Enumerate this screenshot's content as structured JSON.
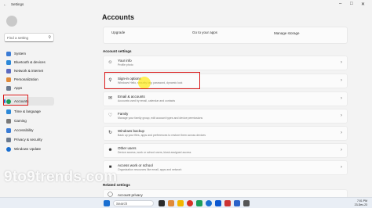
{
  "window": {
    "app_title": "Settings"
  },
  "sidebar": {
    "search_placeholder": "Find a setting",
    "items": [
      {
        "label": "System",
        "color": "#3a7bd5"
      },
      {
        "label": "Bluetooth & devices",
        "color": "#2b88d8"
      },
      {
        "label": "Network & internet",
        "color": "#5c6bc0"
      },
      {
        "label": "Personalization",
        "color": "#e08a3a"
      },
      {
        "label": "Apps",
        "color": "#6b7a8f"
      },
      {
        "label": "Accounts",
        "color": "#1a9e5a",
        "active": true
      },
      {
        "label": "Time & language",
        "color": "#2b88d8"
      },
      {
        "label": "Gaming",
        "color": "#7a7a7a"
      },
      {
        "label": "Accessibility",
        "color": "#3a7bd5"
      },
      {
        "label": "Privacy & security",
        "color": "#6b7a8f"
      },
      {
        "label": "Windows Update",
        "color": "#1a6fd1"
      }
    ]
  },
  "main": {
    "title": "Accounts",
    "top_card": {
      "upgrade": "Upgrade",
      "go_to_apps": "Go to your apps",
      "manage_storage": "Manage storage"
    },
    "section_account_settings": "Account settings",
    "rows": [
      {
        "title": "Your info",
        "subtitle": "Profile photo",
        "icon": "person-icon"
      },
      {
        "title": "Sign-in options",
        "subtitle": "Windows Hello, security key, password, dynamic lock",
        "icon": "key-icon"
      },
      {
        "title": "Email & accounts",
        "subtitle": "Accounts used by email, calendar and contacts",
        "icon": "mail-icon"
      },
      {
        "title": "Family",
        "subtitle": "Manage your family group, edit account types and device permissions",
        "icon": "heart-icon"
      },
      {
        "title": "Windows backup",
        "subtitle": "Back up your files, apps and preferences to restore them across devices",
        "icon": "backup-icon"
      },
      {
        "title": "Other users",
        "subtitle": "Device access, work or school users, kiosk assigned access",
        "icon": "users-icon"
      },
      {
        "title": "Access work or school",
        "subtitle": "Organization resources like email, apps and network",
        "icon": "briefcase-icon"
      }
    ],
    "section_related": "Related settings",
    "related_rows": [
      {
        "title": "Account privacy",
        "icon": "shield-icon"
      }
    ]
  },
  "watermark": "9to9trends.com",
  "taskbar": {
    "search_label": "Search",
    "time": "7:01 PM",
    "date": "23-Dec-23",
    "icons": [
      "#1a6fd1",
      "#2a2a2a",
      "#e08a3a",
      "#f2b600",
      "#d93025",
      "#1a9e5a",
      "#1a6fd1",
      "#0b57d0",
      "#c33",
      "#2a62c9",
      "#555"
    ]
  }
}
